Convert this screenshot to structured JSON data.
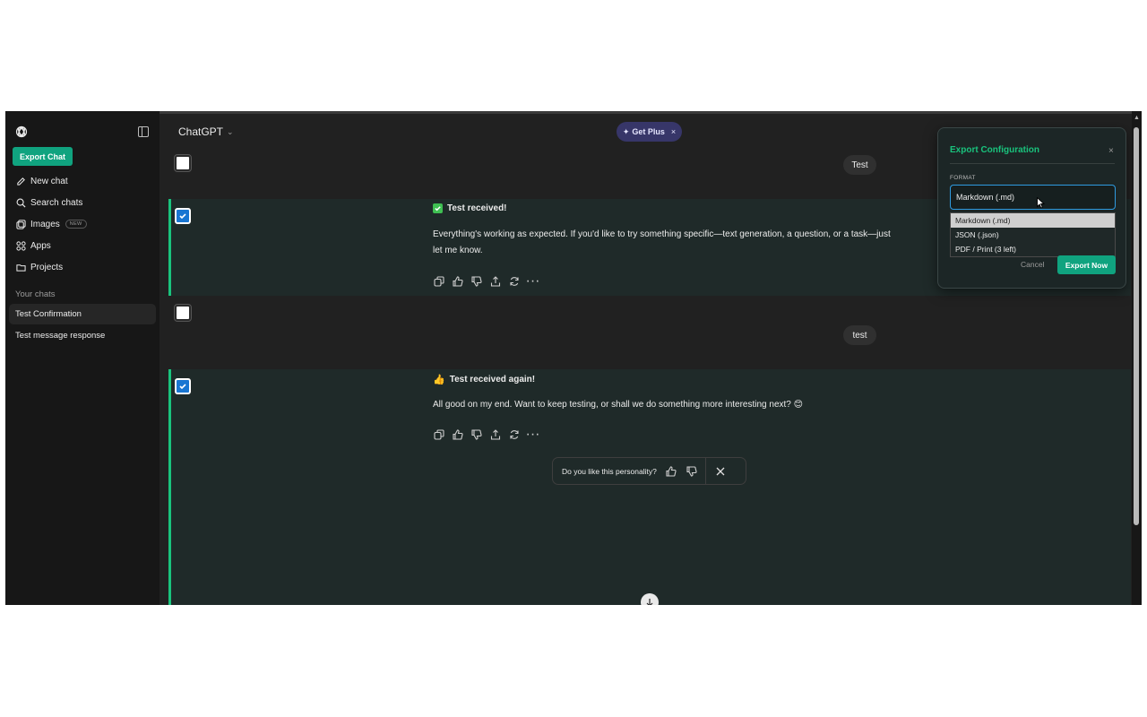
{
  "sidebar": {
    "export_chat_label": "Export Chat",
    "items": [
      {
        "label": "New chat",
        "icon": "edit-icon"
      },
      {
        "label": "Search chats",
        "icon": "search-icon"
      },
      {
        "label": "Images",
        "icon": "images-icon",
        "badge": "NEW"
      },
      {
        "label": "Apps",
        "icon": "apps-icon"
      },
      {
        "label": "Projects",
        "icon": "folder-icon"
      }
    ],
    "section_title": "Your chats",
    "chats": [
      {
        "label": "Test Confirmation",
        "active": true
      },
      {
        "label": "Test message response",
        "active": false
      }
    ]
  },
  "header": {
    "model_name": "ChatGPT",
    "get_plus_label": "Get Plus",
    "get_plus_close": "×"
  },
  "messages": {
    "user1": "Test",
    "assistant1": {
      "title": "Test received!",
      "text": "Everything's working as expected. If you'd like to try something specific—text generation, a question, or a task—just let me know."
    },
    "user2": "test",
    "assistant2": {
      "title": "Test received again!",
      "text": "All good on my end. Want to keep testing, or shall we do something more interesting next? 😊"
    }
  },
  "personality_prompt": "Do you like this personality?",
  "export_panel": {
    "title": "Export Configuration",
    "close": "×",
    "format_label": "FORMAT",
    "selected_value": "Markdown (.md)",
    "options": [
      "Markdown (.md)",
      "JSON (.json)",
      "PDF / Print (3 left)"
    ],
    "cancel_label": "Cancel",
    "export_label": "Export Now"
  },
  "colors": {
    "accent": "#10a37f",
    "selected_border": "#19c37d",
    "checkbox_checked": "#1976d2"
  }
}
